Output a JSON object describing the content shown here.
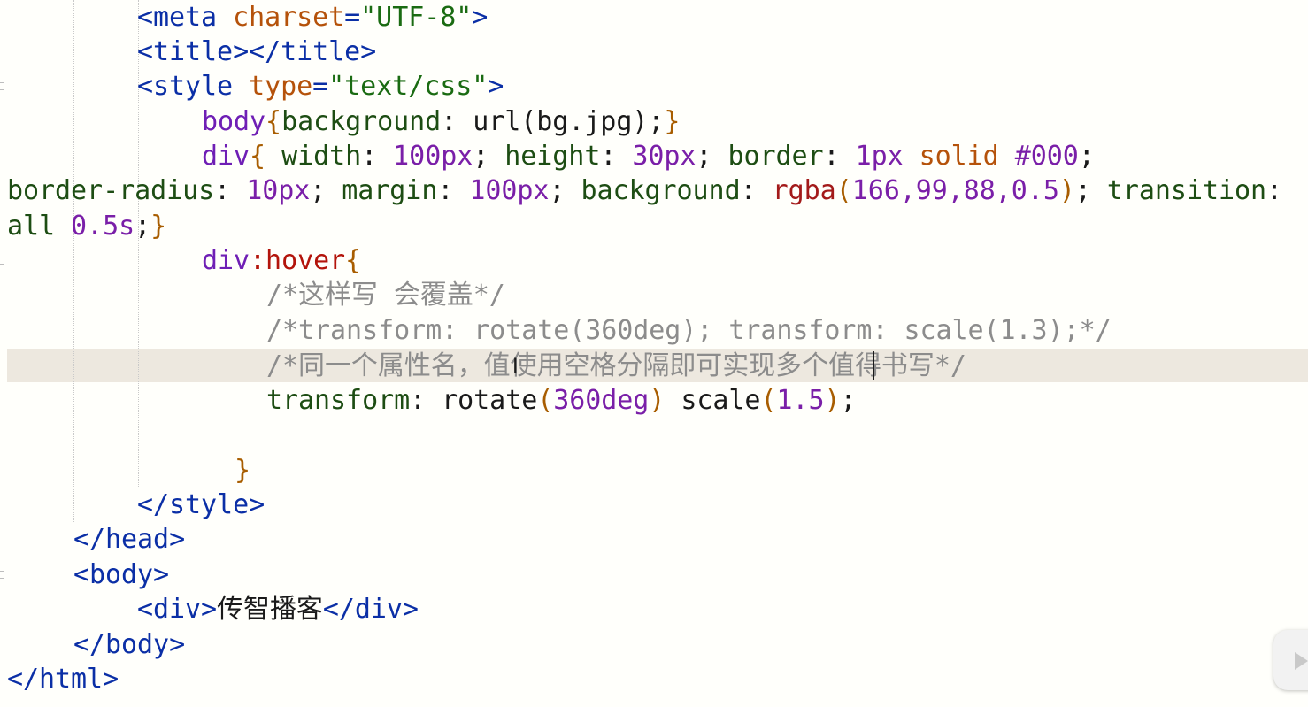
{
  "editor": {
    "lines": [
      {
        "segments": [
          {
            "text": "<",
            "kind": "tag"
          },
          {
            "text": "meta",
            "kind": "tag"
          },
          {
            "text": " charset",
            "kind": "attr"
          },
          {
            "text": "=",
            "kind": "tag"
          },
          {
            "text": "\"UTF-8\"",
            "kind": "str"
          },
          {
            "text": ">",
            "kind": "tag"
          }
        ]
      },
      {
        "segments": [
          {
            "text": "<title></title>",
            "kind": "tag"
          }
        ]
      },
      {
        "segments": [
          {
            "text": "<style",
            "kind": "tag"
          },
          {
            "text": " type",
            "kind": "attr"
          },
          {
            "text": "=",
            "kind": "tag"
          },
          {
            "text": "\"text/css\"",
            "kind": "str"
          },
          {
            "text": ">",
            "kind": "tag"
          }
        ]
      },
      {
        "segments": [
          {
            "text": "body",
            "kind": "sel"
          },
          {
            "text": "{",
            "kind": "brace"
          },
          {
            "text": "background",
            "kind": "prop"
          },
          {
            "text": ": ",
            "kind": "txt"
          },
          {
            "text": "url(bg.jpg);",
            "kind": "txt"
          },
          {
            "text": "}",
            "kind": "brace"
          }
        ]
      },
      {
        "segments": [
          {
            "text": "div",
            "kind": "sel"
          },
          {
            "text": "{",
            "kind": "brace"
          },
          {
            "text": " width",
            "kind": "prop"
          },
          {
            "text": ": ",
            "kind": "txt"
          },
          {
            "text": "100px",
            "kind": "num"
          },
          {
            "text": "; ",
            "kind": "txt"
          },
          {
            "text": "height",
            "kind": "prop"
          },
          {
            "text": ": ",
            "kind": "txt"
          },
          {
            "text": "30px",
            "kind": "num"
          },
          {
            "text": "; ",
            "kind": "txt"
          },
          {
            "text": "border",
            "kind": "prop"
          },
          {
            "text": ": ",
            "kind": "txt"
          },
          {
            "text": "1px",
            "kind": "num"
          },
          {
            "text": " solid",
            "kind": "kw"
          },
          {
            "text": " #000",
            "kind": "num"
          },
          {
            "text": ";",
            "kind": "txt"
          }
        ]
      },
      {
        "segments": [
          {
            "text": "border-radius",
            "kind": "prop"
          },
          {
            "text": ": ",
            "kind": "txt"
          },
          {
            "text": "10px",
            "kind": "num"
          },
          {
            "text": "; ",
            "kind": "txt"
          },
          {
            "text": "margin",
            "kind": "prop"
          },
          {
            "text": ": ",
            "kind": "txt"
          },
          {
            "text": "100px",
            "kind": "num"
          },
          {
            "text": "; ",
            "kind": "txt"
          },
          {
            "text": "background",
            "kind": "prop"
          },
          {
            "text": ": ",
            "kind": "txt"
          },
          {
            "text": "rgba",
            "kind": "fn"
          },
          {
            "text": "(",
            "kind": "brace"
          },
          {
            "text": "166,99,88,0.5",
            "kind": "num"
          },
          {
            "text": ")",
            "kind": "brace"
          },
          {
            "text": "; ",
            "kind": "txt"
          },
          {
            "text": "transition",
            "kind": "prop"
          },
          {
            "text": ":",
            "kind": "txt"
          }
        ]
      },
      {
        "segments": [
          {
            "text": "all",
            "kind": "prop"
          },
          {
            "text": " 0.5s",
            "kind": "num"
          },
          {
            "text": ";",
            "kind": "txt"
          },
          {
            "text": "}",
            "kind": "brace"
          }
        ]
      },
      {
        "segments": [
          {
            "text": "div",
            "kind": "sel"
          },
          {
            "text": ":hover",
            "kind": "pseudo"
          },
          {
            "text": "{",
            "kind": "brace"
          }
        ]
      },
      {
        "segments": [
          {
            "text": "/*这样写 会覆盖*/",
            "kind": "cmt"
          }
        ]
      },
      {
        "segments": [
          {
            "text": "/*transform: rotate(360deg); transform: scale(1.3);*/",
            "kind": "cmt"
          }
        ]
      },
      {
        "segments": [
          {
            "text": "/*同一个属性名，值使用空格分隔即可实现多个值得书写*/",
            "kind": "cmt"
          }
        ]
      },
      {
        "segments": [
          {
            "text": "transform",
            "kind": "prop"
          },
          {
            "text": ": ",
            "kind": "txt"
          },
          {
            "text": "rotate",
            "kind": "txt"
          },
          {
            "text": "(",
            "kind": "brace"
          },
          {
            "text": "360deg",
            "kind": "num"
          },
          {
            "text": ")",
            "kind": "brace"
          },
          {
            "text": " scale",
            "kind": "txt"
          },
          {
            "text": "(",
            "kind": "brace"
          },
          {
            "text": "1.5",
            "kind": "num"
          },
          {
            "text": ")",
            "kind": "brace"
          },
          {
            "text": ";",
            "kind": "txt"
          }
        ]
      },
      {
        "segments": []
      },
      {
        "segments": [
          {
            "text": "}",
            "kind": "brace"
          }
        ]
      },
      {
        "segments": [
          {
            "text": "</style>",
            "kind": "tag"
          }
        ]
      },
      {
        "segments": [
          {
            "text": "</head>",
            "kind": "tag"
          }
        ]
      },
      {
        "segments": [
          {
            "text": "<body>",
            "kind": "tag"
          }
        ]
      },
      {
        "segments": [
          {
            "text": "<div>",
            "kind": "tag"
          },
          {
            "text": "传智播客",
            "kind": "txt"
          },
          {
            "text": "</div>",
            "kind": "tag"
          }
        ]
      },
      {
        "segments": [
          {
            "text": "</body>",
            "kind": "tag"
          }
        ]
      },
      {
        "segments": [
          {
            "text": "</html>",
            "kind": "tag"
          }
        ]
      }
    ],
    "active_line": 11,
    "colors": {
      "background": "#fffffb",
      "active_line": "#ede8df",
      "tag": "#0b2fa6",
      "attribute": "#b5520a",
      "string": "#1a6b12",
      "selector": "#6f1fb5",
      "property": "#1d4d13",
      "number": "#7a1fa8",
      "function": "#a31a1a",
      "comment": "#8c8c8c"
    }
  },
  "overlay": {
    "icon": "play-icon"
  }
}
